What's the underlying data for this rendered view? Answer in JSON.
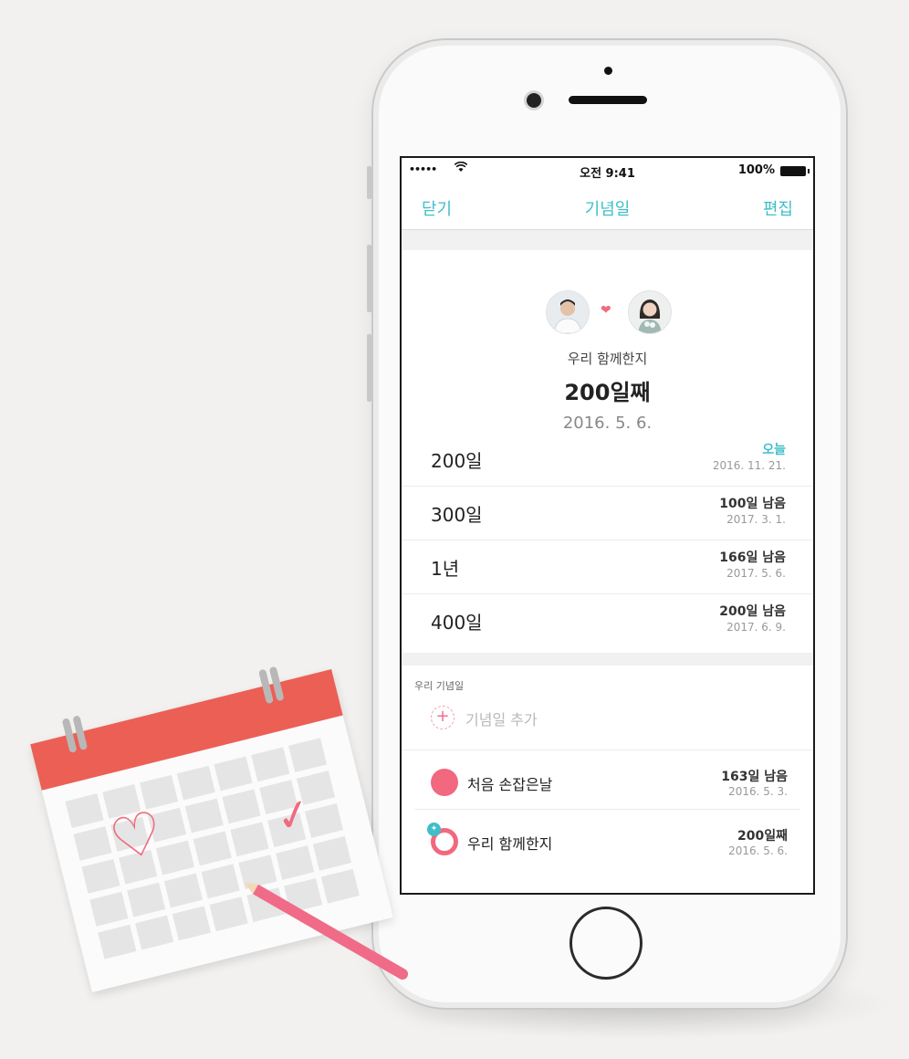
{
  "status_bar": {
    "signal": "•••••",
    "time": "오전 9:41",
    "battery": "100%"
  },
  "nav": {
    "close": "닫기",
    "title": "기념일",
    "edit": "편집"
  },
  "couple": {
    "label": "우리 함께한지",
    "day_count": "200일째",
    "start_date": "2016. 5. 6."
  },
  "milestones": [
    {
      "name": "200일",
      "status": "오늘",
      "date": "2016. 11. 21."
    },
    {
      "name": "300일",
      "status": "100일 남음",
      "date": "2017. 3. 1."
    },
    {
      "name": "1년",
      "status": "166일 남음",
      "date": "2017. 5. 6."
    },
    {
      "name": "400일",
      "status": "200일 남음",
      "date": "2017. 6. 9."
    }
  ],
  "anniversaries": {
    "section_label": "우리 기념일",
    "add_label": "기념일 추가",
    "items": [
      {
        "name": "처음 손잡은날",
        "status": "163일 남음",
        "date": "2016. 5. 3."
      },
      {
        "name": "우리 함께한지",
        "status": "200일째",
        "date": "2016. 5. 6."
      }
    ]
  },
  "colors": {
    "accent": "#3ebfc9",
    "pink": "#f2687e",
    "calendar_red": "#ec5f55"
  }
}
